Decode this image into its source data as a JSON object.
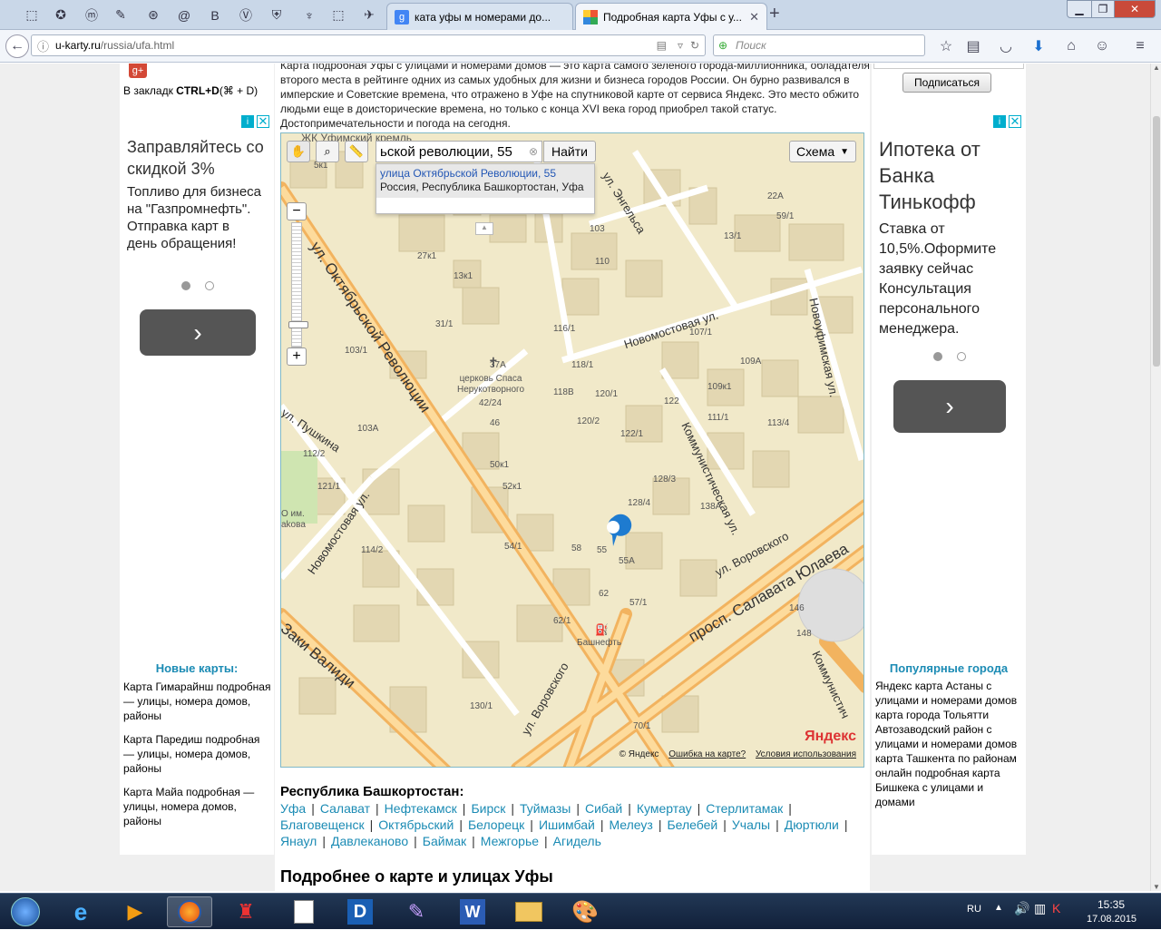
{
  "browser": {
    "tabs": [
      {
        "label": "ката уфы м номерами до...",
        "active": false
      },
      {
        "label": "Подробная карта Уфы с у...",
        "active": true
      }
    ],
    "url_host": "u-karty.ru",
    "url_path": "/russia/ufa.html",
    "search_placeholder": "Поиск"
  },
  "left": {
    "bookmark_prefix": "В закладк ",
    "bookmark_keys": "CTRL+D",
    "bookmark_suffix": "(⌘ + D)",
    "ad": {
      "title": "Заправляйтесь со скидкой 3%",
      "body": "Топливо для бизнеса на \"Газпромнефть\". Отправка карт в день обращения!"
    },
    "new_maps_title": "Новые карты:",
    "new_maps": [
      "Карта Гимарайнш подробная — улицы, номера домов, районы",
      "Карта Паредиш подробная — улицы, номера домов, районы",
      "Карта Майа подробная — улицы, номера домов, районы"
    ]
  },
  "center": {
    "intro": "Карта подробная Уфы с улицами и номерами домов — это карта самого зеленого города-миллионника, обладателя второго места в рейтинге одних из самых удобных для жизни и бизнеса городов России.  Он бурно развивался в имперские и Советские времена, что отражено в Уфе на спутниковой карте от сервиса Яндекс. Это место обжито людьми еще в доисторические времена, но только с конца XVI века город приобрел такой статус. Достопримечательности и погода на сегодня.",
    "map": {
      "search_value": "ьской революции, 55",
      "find_button": "Найти",
      "layer_button": "Схема",
      "suggest_title": "улица Октябрьской Революции, 55",
      "suggest_sub": "Россия, Республика Башкортостан, Уфа",
      "streets": {
        "oktyabr": "ул. Октябрьской Революции",
        "pushkin": "ул. Пушкина",
        "novomost1": "Новомостовая ул.",
        "novomost2": "Новомостовая ул.",
        "engels": "ул. Энгельса",
        "novougush": "Новоуфимская ул.",
        "kommun": "Коммунистическая ул.",
        "vorovsk1": "ул. Воровского",
        "vorovsk2": "ул. Воровского",
        "salavat": "просп. Салавата Юлаева",
        "zaki": "Заки Валиди",
        "kommun2": "Коммунистич"
      },
      "pois": {
        "church": "церковь Спаса Нерукотворного",
        "fuel": "Башнефть",
        "kremlin": "ЖК Уфимский кремль",
        "park": "О им. аkова"
      },
      "copyright": "© Яндекс",
      "error_link": "Ошибка на карте?",
      "terms_link": "Условия использования",
      "logo": "Яндекс"
    },
    "region_title": "Республика Башкортостан:",
    "cities": [
      "Уфа",
      "Салават",
      "Нефтекамск",
      "Бирск",
      "Туймазы",
      "Сибай",
      "Кумертау",
      "Стерлитамак",
      "Благовещенск",
      "Октябрьский",
      "Белорецк",
      "Ишимбай",
      "Мелеуз",
      "Белебей",
      "Учалы",
      "Дюртюли",
      "Янаул",
      "Давлеканово",
      "Баймак",
      "Межгорье",
      "Агидель"
    ],
    "details_title": "Подробнее о карте и улицах Уфы"
  },
  "right": {
    "subscribe": "Подписаться",
    "ad": {
      "title": "Ипотека от Банка Тинькофф",
      "body": "Ставка от 10,5%.Оформите заявку сейчас Консультация персонального менеджера."
    },
    "popular_title": "Популярные города",
    "popular": [
      "Яндекс карта Астаны с улицами и номерами домов",
      "карта города Тольятти Автозаводский район с улицами и номерами домов",
      "карта Ташкента по районам онлайн подробная карта Бишкека с улицами и домами"
    ]
  },
  "taskbar": {
    "lang": "RU",
    "time": "15:35",
    "date": "17.08.2015"
  }
}
